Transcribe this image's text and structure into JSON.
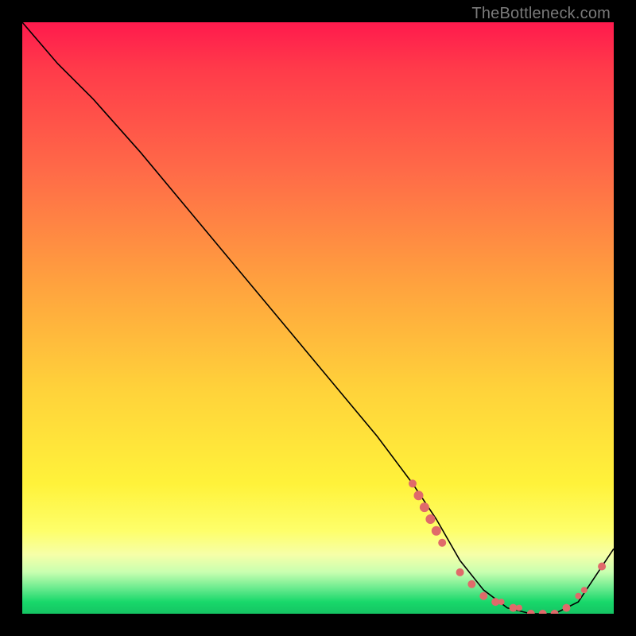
{
  "attribution": "TheBottleneck.com",
  "chart_data": {
    "type": "line",
    "title": "",
    "xlabel": "",
    "ylabel": "",
    "xlim": [
      0,
      100
    ],
    "ylim": [
      0,
      100
    ],
    "grid": false,
    "legend": false,
    "series": [
      {
        "name": "curve",
        "x": [
          0,
          6,
          12,
          20,
          30,
          40,
          50,
          60,
          66,
          70,
          74,
          78,
          82,
          86,
          90,
          94,
          100
        ],
        "y": [
          100,
          93,
          87,
          78,
          66,
          54,
          42,
          30,
          22,
          16,
          9,
          4,
          1,
          0,
          0,
          2,
          11
        ],
        "color": "#000000"
      }
    ],
    "markers": [
      {
        "x": 66,
        "y": 22,
        "r": 5,
        "color": "#e06a6a"
      },
      {
        "x": 67,
        "y": 20,
        "r": 6,
        "color": "#e06a6a"
      },
      {
        "x": 68,
        "y": 18,
        "r": 6,
        "color": "#e06a6a"
      },
      {
        "x": 69,
        "y": 16,
        "r": 6,
        "color": "#e06a6a"
      },
      {
        "x": 70,
        "y": 14,
        "r": 6,
        "color": "#e06a6a"
      },
      {
        "x": 71,
        "y": 12,
        "r": 5,
        "color": "#e06a6a"
      },
      {
        "x": 74,
        "y": 7,
        "r": 5,
        "color": "#e06a6a"
      },
      {
        "x": 76,
        "y": 5,
        "r": 5,
        "color": "#e06a6a"
      },
      {
        "x": 78,
        "y": 3,
        "r": 5,
        "color": "#e06a6a"
      },
      {
        "x": 80,
        "y": 2,
        "r": 5,
        "color": "#e06a6a"
      },
      {
        "x": 81,
        "y": 2,
        "r": 4,
        "color": "#e06a6a"
      },
      {
        "x": 83,
        "y": 1,
        "r": 5,
        "color": "#e06a6a"
      },
      {
        "x": 84,
        "y": 1,
        "r": 4,
        "color": "#e06a6a"
      },
      {
        "x": 86,
        "y": 0,
        "r": 5,
        "color": "#e06a6a"
      },
      {
        "x": 88,
        "y": 0,
        "r": 5,
        "color": "#e06a6a"
      },
      {
        "x": 90,
        "y": 0,
        "r": 5,
        "color": "#e06a6a"
      },
      {
        "x": 92,
        "y": 1,
        "r": 5,
        "color": "#e06a6a"
      },
      {
        "x": 94,
        "y": 3,
        "r": 4,
        "color": "#e06a6a"
      },
      {
        "x": 95,
        "y": 4,
        "r": 4,
        "color": "#e06a6a"
      },
      {
        "x": 98,
        "y": 8,
        "r": 5,
        "color": "#e06a6a"
      }
    ]
  }
}
